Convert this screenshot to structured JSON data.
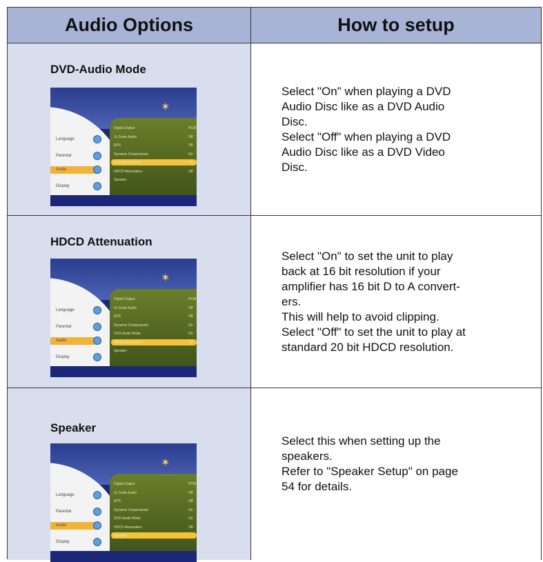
{
  "header": {
    "left": "Audio Options",
    "right": "How to setup"
  },
  "rows": [
    {
      "title": "DVD-Audio Mode",
      "desc": [
        "Select \"On\" when playing a DVD",
        "Audio Disc like as a DVD Audio",
        "Disc.",
        "Select \"Off\" when playing a DVD",
        "Audio Disc like as a DVD Video",
        "Disc."
      ]
    },
    {
      "title": "HDCD Attenuation",
      "desc": [
        "Select \"On\" to set the unit to play",
        "back at 16 bit resolution if your",
        "amplifier has 16 bit D to A convert-",
        "ers.",
        "This will help to avoid clipping.",
        "Select \"Off\" to set the unit to play at",
        "standard 20 bit HDCD resolution."
      ]
    },
    {
      "title": "Speaker",
      "desc": [
        "Select this when setting up the",
        "speakers.",
        "Refer to \"Speaker Setup\" on page",
        "54 for details."
      ]
    }
  ],
  "menu_screenshot": {
    "side_items": [
      "Language",
      "Parental",
      "Audio",
      "Display"
    ],
    "selected_side": "Audio",
    "items": [
      "Digital Output",
      "2x Scale Audio",
      "EPS",
      "Dynamic Compression",
      "DVD-Audio Mode",
      "HDCD Attenuation",
      "Speaker"
    ],
    "values": [
      "PCM",
      "Off",
      "Off",
      "On",
      "On",
      "Off",
      ""
    ],
    "highlighted_per_row": [
      "DVD-Audio Mode",
      "HDCD Attenuation",
      "Speaker"
    ],
    "colors": {
      "background": "#1a2a6a",
      "panel": "#4f6420",
      "highlight": "#f6c23a"
    }
  }
}
